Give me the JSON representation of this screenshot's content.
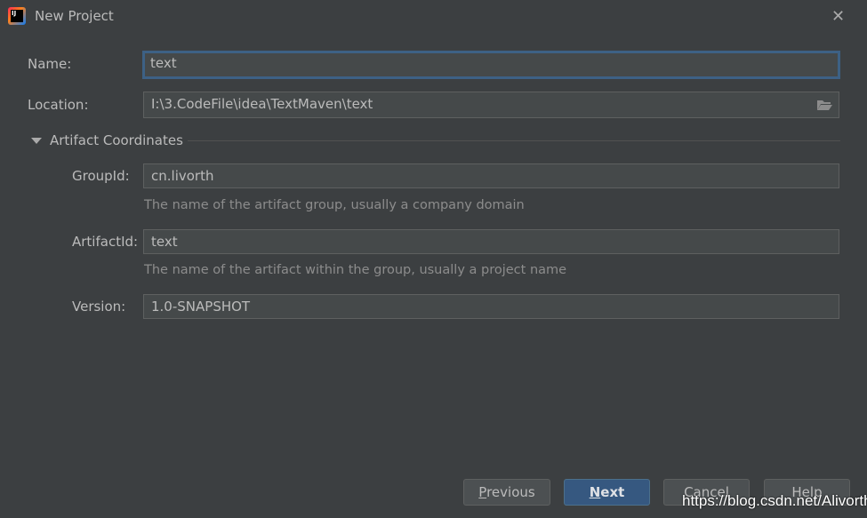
{
  "window": {
    "title": "New Project",
    "icon": "intellij-idea-icon",
    "close_icon": "close-icon"
  },
  "form": {
    "name": {
      "label": "Name:",
      "value": "text"
    },
    "location": {
      "label": "Location:",
      "value": "I:\\3.CodeFile\\idea\\TextMaven\\text",
      "browse_icon": "folder-icon"
    },
    "section": {
      "label": "Artifact Coordinates",
      "expanded": true
    },
    "group_id": {
      "label": "GroupId:",
      "value": "cn.livorth",
      "hint": "The name of the artifact group, usually a company domain"
    },
    "artifact_id": {
      "label": "ArtifactId:",
      "value": "text",
      "hint": "The name of the artifact within the group, usually a project name"
    },
    "version": {
      "label": "Version:",
      "value": "1.0-SNAPSHOT"
    }
  },
  "buttons": {
    "previous_m": "P",
    "previous_rest": "revious",
    "next_m": "N",
    "next_rest": "ext",
    "cancel": "Cancel",
    "help": "Help"
  },
  "watermark": "https://blog.csdn.net/Alivorth",
  "colors": {
    "background": "#3c3f41",
    "focus": "#3d6185",
    "primary": "#365880"
  }
}
